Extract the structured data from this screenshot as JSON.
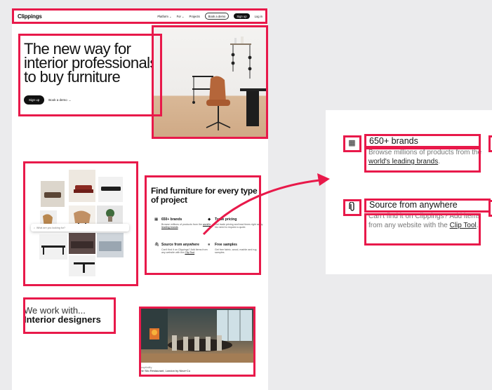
{
  "nav": {
    "logo": "Clippings",
    "links": [
      "Platform ⌄",
      "For ⌄",
      "Projects",
      "Book a demo",
      "Sign up",
      "Log in"
    ]
  },
  "hero": {
    "title": "The new way for interior professionals to buy furniture",
    "signup": "Sign up",
    "book_demo": "Book a demo →"
  },
  "browse": {
    "search_placeholder": "What are you looking for?"
  },
  "find": {
    "title": "Find furniture for every type of project",
    "features": [
      {
        "icon": "grid-icon",
        "title": "650+ brands",
        "text": "Browse millions of products from the ",
        "link": "world's leading brands",
        "tail": "."
      },
      {
        "icon": "tag-icon",
        "title": "Trade pricing",
        "text": "Get trade pricing and lead times right away. No need to request a quote.",
        "link": "",
        "tail": ""
      },
      {
        "icon": "paperclip-icon",
        "title": "Source from anywhere",
        "text": "Can't find it on Clippings? Add items from any website with the ",
        "link": "Clip Tool",
        "tail": "."
      },
      {
        "icon": "swatch-icon",
        "title": "Free samples",
        "text": "Get free fabric, wood, marble and rug samples.",
        "link": "",
        "tail": ""
      }
    ]
  },
  "work": {
    "line1": "We work with...",
    "line2": "Interior designers",
    "caption_category": "Hospitality",
    "caption_title": "The Silo Restaurant, London by Nina+Co"
  },
  "zoom": {
    "brands_title": "650+ brands",
    "brands_text": "Browse millions of products from the ",
    "brands_link": "world's leading brands",
    "brands_tail": ".",
    "source_title": "Source from anywhere",
    "source_text": "Can't find it on Clippings? Add items from any website with the ",
    "source_link": "Clip Tool",
    "source_tail": "."
  },
  "colors": {
    "highlight": "#e8194a",
    "primary": "#111111"
  }
}
